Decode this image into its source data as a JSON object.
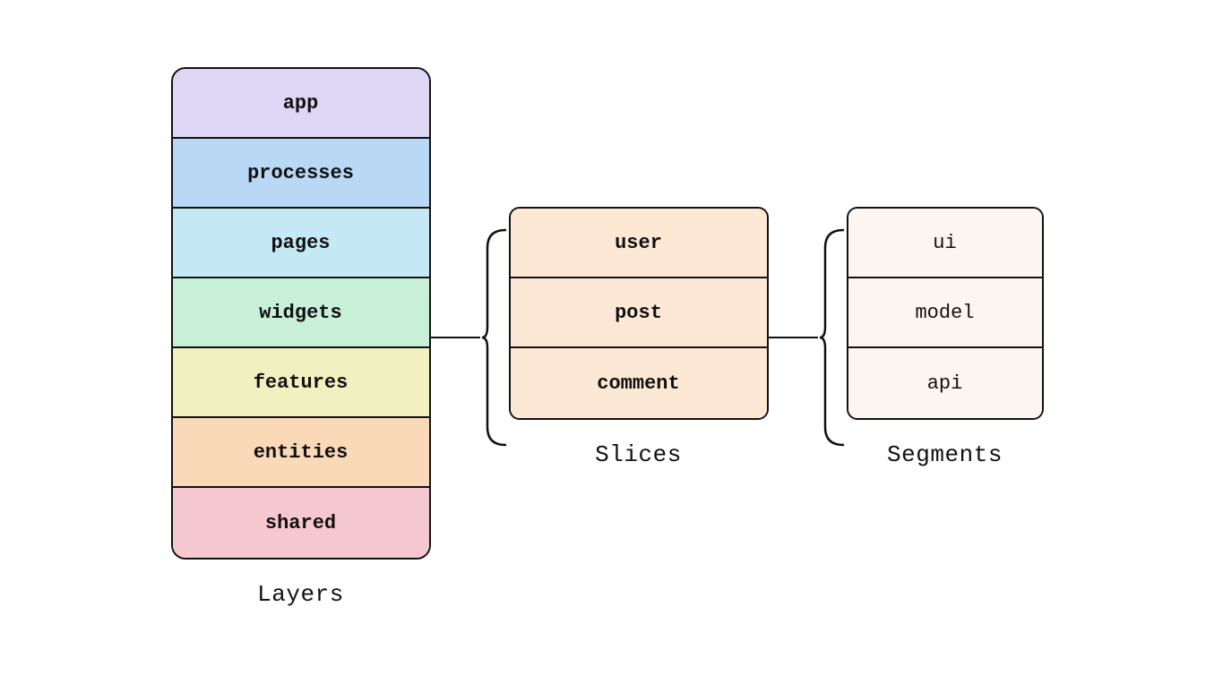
{
  "layers": {
    "label": "Layers",
    "items": [
      {
        "id": "app",
        "label": "app",
        "colorClass": "layer-app"
      },
      {
        "id": "processes",
        "label": "processes",
        "colorClass": "layer-processes"
      },
      {
        "id": "pages",
        "label": "pages",
        "colorClass": "layer-pages"
      },
      {
        "id": "widgets",
        "label": "widgets",
        "colorClass": "layer-widgets"
      },
      {
        "id": "features",
        "label": "features",
        "colorClass": "layer-features"
      },
      {
        "id": "entities",
        "label": "entities",
        "colorClass": "layer-entities"
      },
      {
        "id": "shared",
        "label": "shared",
        "colorClass": "layer-shared"
      }
    ]
  },
  "slices": {
    "label": "Slices",
    "items": [
      {
        "id": "user",
        "label": "user"
      },
      {
        "id": "post",
        "label": "post"
      },
      {
        "id": "comment",
        "label": "comment"
      }
    ]
  },
  "segments": {
    "label": "Segments",
    "items": [
      {
        "id": "ui",
        "label": "ui"
      },
      {
        "id": "model",
        "label": "model"
      },
      {
        "id": "api",
        "label": "api"
      }
    ]
  }
}
